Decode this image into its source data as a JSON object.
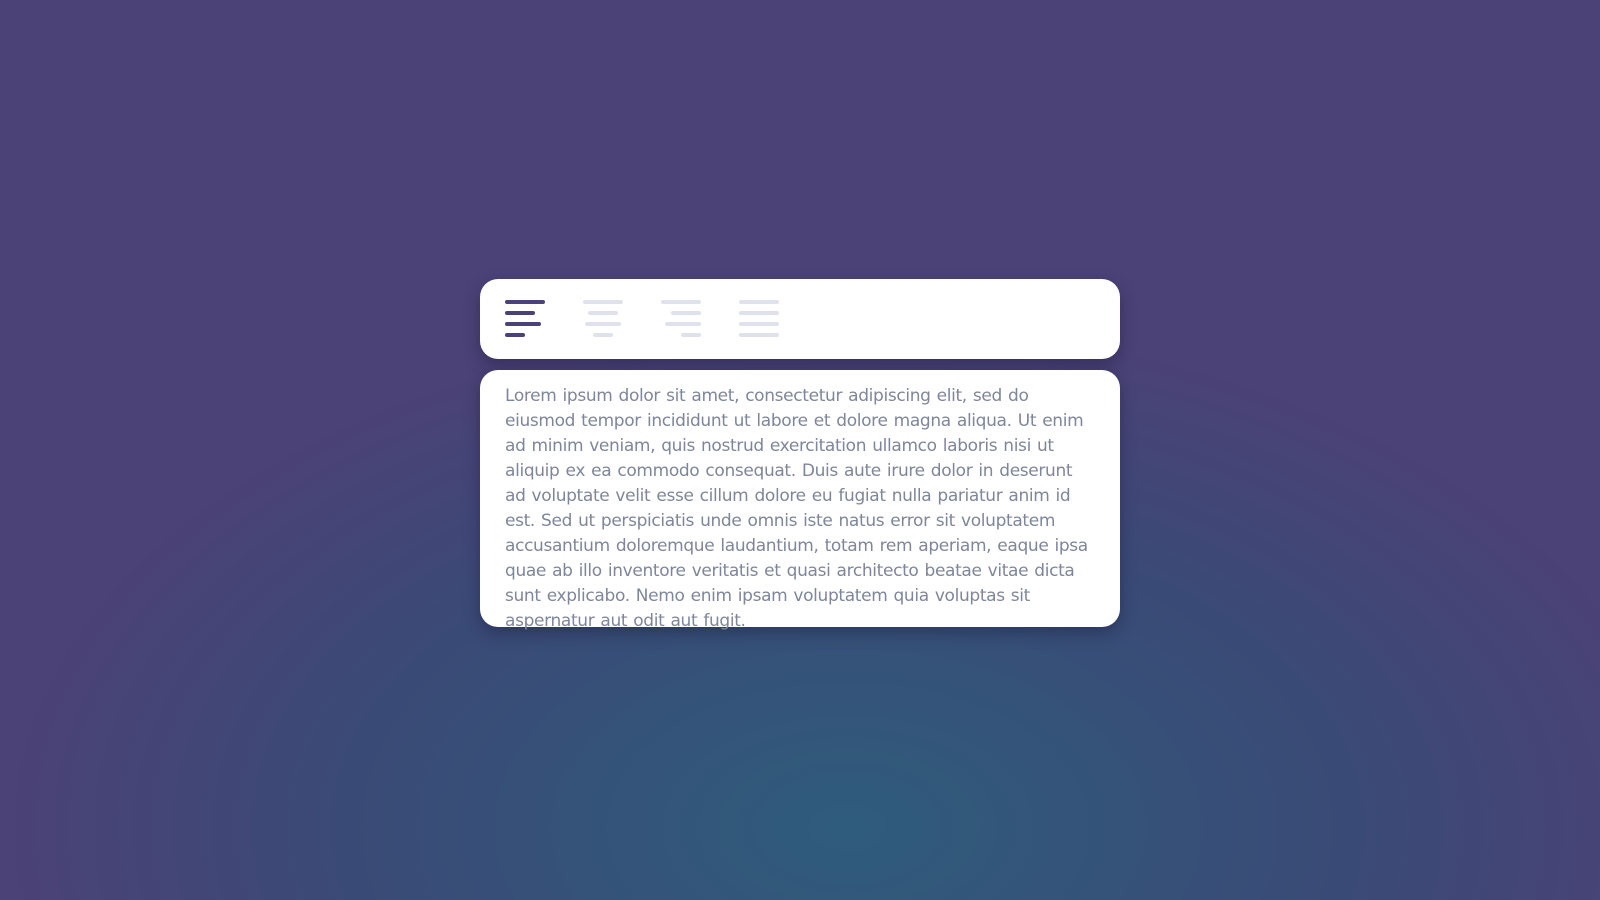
{
  "toolbar": {
    "buttons": [
      {
        "icon": "align-left-icon",
        "active": true
      },
      {
        "icon": "align-center-icon",
        "active": false
      },
      {
        "icon": "align-right-icon",
        "active": false
      },
      {
        "icon": "align-justify-icon",
        "active": false
      }
    ],
    "active_color": "#4b4277",
    "inactive_color": "#dfe1ec"
  },
  "editor": {
    "text": "Lorem ipsum dolor sit amet, consectetur adipiscing elit, sed do eiusmod tempor incididunt ut labore et dolore magna aliqua. Ut enim ad minim veniam, quis nostrud exercitation ullamco laboris nisi ut aliquip ex ea commodo consequat. Duis aute irure dolor in deserunt ad voluptate velit esse cillum dolore eu fugiat nulla pariatur anim id est. Sed ut perspiciatis unde omnis iste natus error sit voluptatem accusantium doloremque laudantium, totam rem aperiam, eaque ipsa quae ab illo inventore veritatis et quasi architecto beatae vitae dicta sunt explicabo. Nemo enim ipsam voluptatem quia voluptas sit aspernatur aut odit aut fugit.",
    "alignment": "left",
    "text_color": "#7f8699"
  }
}
